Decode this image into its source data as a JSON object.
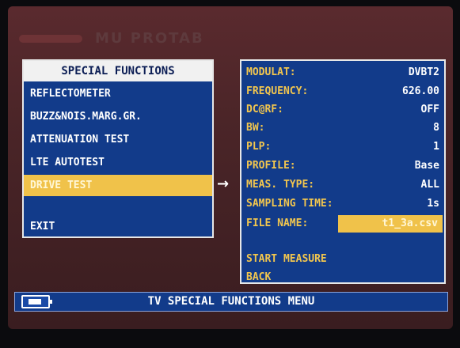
{
  "brand": {
    "text": "MU PROTAB"
  },
  "left_panel": {
    "title": "SPECIAL FUNCTIONS",
    "items": [
      {
        "label": "REFLECTOMETER"
      },
      {
        "label": "BUZZ&NOIS.MARG.GR."
      },
      {
        "label": "ATTENUATION TEST"
      },
      {
        "label": "LTE AUTOTEST"
      },
      {
        "label": "DRIVE TEST",
        "selected": true
      },
      {
        "label": "EXIT"
      }
    ]
  },
  "arrow": "→",
  "right_panel": {
    "params": [
      {
        "label": "MODULAT:",
        "value": "DVBT2"
      },
      {
        "label": "FREQUENCY:",
        "value": "626.00"
      },
      {
        "label": "DC@RF:",
        "value": "OFF"
      },
      {
        "label": "BW:",
        "value": "8"
      },
      {
        "label": "PLP:",
        "value": "1"
      },
      {
        "label": "PROFILE:",
        "value": "Base"
      },
      {
        "label": "MEAS. TYPE:",
        "value": "ALL"
      },
      {
        "label": "SAMPLING TIME:",
        "value": "1s"
      },
      {
        "label": "FILE NAME:",
        "value": "t1_3a.csv"
      }
    ],
    "actions": [
      {
        "label": "START MEASURE"
      },
      {
        "label": "BACK"
      }
    ]
  },
  "statusbar": {
    "title": "TV SPECIAL FUNCTIONS MENU",
    "icon": "battery-plug-icon"
  },
  "colors": {
    "panel_bg": "#123b8a",
    "highlight": "#f0c24a",
    "label_yellow": "#f2c64e",
    "frame_bg": "#4b2528"
  }
}
